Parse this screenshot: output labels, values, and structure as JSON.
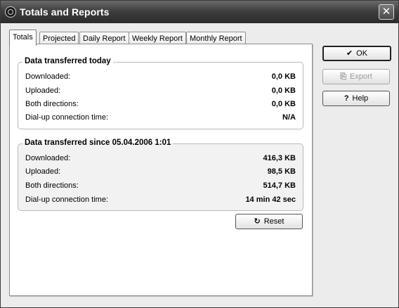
{
  "window": {
    "title": "Totals and Reports",
    "close_glyph": "✕"
  },
  "tabs": [
    {
      "label": "Totals",
      "active": true
    },
    {
      "label": "Projected",
      "active": false
    },
    {
      "label": "Daily Report",
      "active": false
    },
    {
      "label": "Weekly Report",
      "active": false
    },
    {
      "label": "Monthly Report",
      "active": false
    }
  ],
  "today": {
    "title": "Data transferred today",
    "rows": [
      {
        "label": "Downloaded:",
        "value": "0,0 KB"
      },
      {
        "label": "Uploaded:",
        "value": "0,0 KB"
      },
      {
        "label": "Both directions:",
        "value": "0,0 KB"
      },
      {
        "label": "Dial-up connection time:",
        "value": "N/A"
      }
    ]
  },
  "since": {
    "title": "Data transferred since 05.04.2006 1:01",
    "rows": [
      {
        "label": "Downloaded:",
        "value": "416,3 KB"
      },
      {
        "label": "Uploaded:",
        "value": "98,5 KB"
      },
      {
        "label": "Both directions:",
        "value": "514,7 KB"
      },
      {
        "label": "Dial-up connection time:",
        "value": "14 min 42 sec"
      }
    ]
  },
  "buttons": {
    "ok": {
      "label": "OK",
      "icon": "checkmark-icon",
      "glyph": "✔"
    },
    "export": {
      "label": "Export",
      "icon": "export-icon",
      "glyph": "⎘"
    },
    "help": {
      "label": "Help",
      "icon": "question-icon",
      "glyph": "?"
    },
    "reset": {
      "label": "Reset",
      "icon": "refresh-icon",
      "glyph": "↻"
    }
  }
}
